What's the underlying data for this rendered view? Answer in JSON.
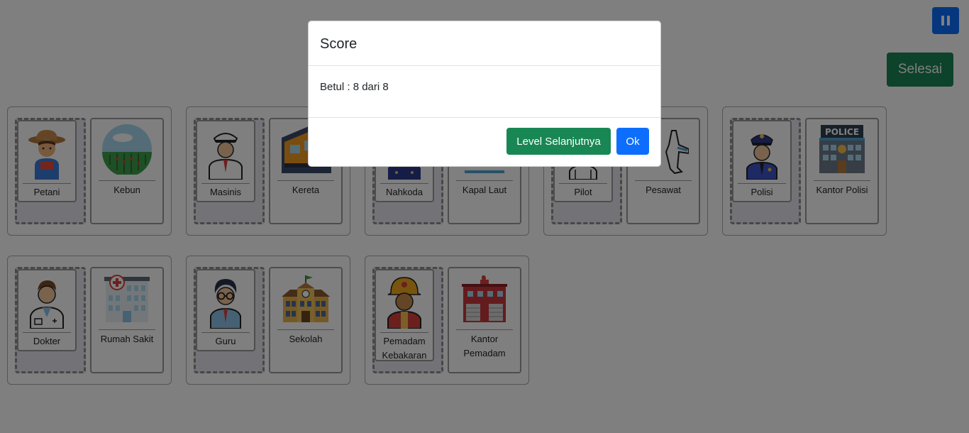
{
  "controls": {
    "pause_icon": "pause-icon",
    "finish_label": "Selesai"
  },
  "pairs": [
    {
      "person": "Petani",
      "place": "Kebun",
      "person_icon": "farmer-icon",
      "place_icon": "farm-field-icon"
    },
    {
      "person": "Masinis",
      "place": "Kereta",
      "person_icon": "train-driver-icon",
      "place_icon": "train-icon"
    },
    {
      "person": "Nahkoda",
      "place": "Kapal Laut",
      "person_icon": "ship-captain-icon",
      "place_icon": "ship-icon"
    },
    {
      "person": "Pilot",
      "place": "Pesawat",
      "person_icon": "pilot-icon",
      "place_icon": "airplane-icon"
    },
    {
      "person": "Polisi",
      "place": "Kantor Polisi",
      "person_icon": "police-officer-icon",
      "place_icon": "police-station-icon",
      "place_sign": "POLICE"
    },
    {
      "person": "Dokter",
      "place": "Rumah Sakit",
      "person_icon": "doctor-icon",
      "place_icon": "hospital-icon"
    },
    {
      "person": "Guru",
      "place": "Sekolah",
      "person_icon": "teacher-icon",
      "place_icon": "school-icon"
    },
    {
      "person": "Pemadam Kebakaran",
      "place": "Kantor Pemadam",
      "person_icon": "firefighter-icon",
      "place_icon": "fire-station-icon"
    }
  ],
  "modal": {
    "title": "Score",
    "body": "Betul : 8 dari 8",
    "next_level_label": "Level Selanjutnya",
    "ok_label": "Ok"
  },
  "colors": {
    "primary": "#0d6efd",
    "success": "#198754",
    "overlay": "rgba(0,0,0,0.5)"
  }
}
